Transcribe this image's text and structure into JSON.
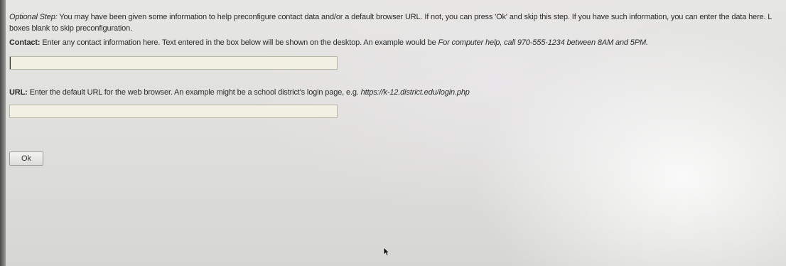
{
  "intro": {
    "optional_label": "Optional Step:",
    "line1_rest": " You may have been given some information to help preconfigure contact data and/or a default browser URL. If not, you can press 'Ok' and skip this step. If you have such information, you can enter the data here. L",
    "line2": "boxes blank to skip preconfiguration."
  },
  "contact": {
    "label": "Contact:",
    "description": " Enter any contact information here. Text entered in the box below will be shown on the desktop. An example would be ",
    "example": "For computer help, call 970-555-1234 between 8AM and 5PM.",
    "value": ""
  },
  "url": {
    "label": "URL:",
    "description": " Enter the default URL for the web browser. An example might be a school district's login page, e.g. ",
    "example": "https://k-12.district.edu/login.php",
    "value": ""
  },
  "ok_button": {
    "label": "Ok"
  },
  "icons": {
    "cursor": "mouse-pointer-icon"
  }
}
